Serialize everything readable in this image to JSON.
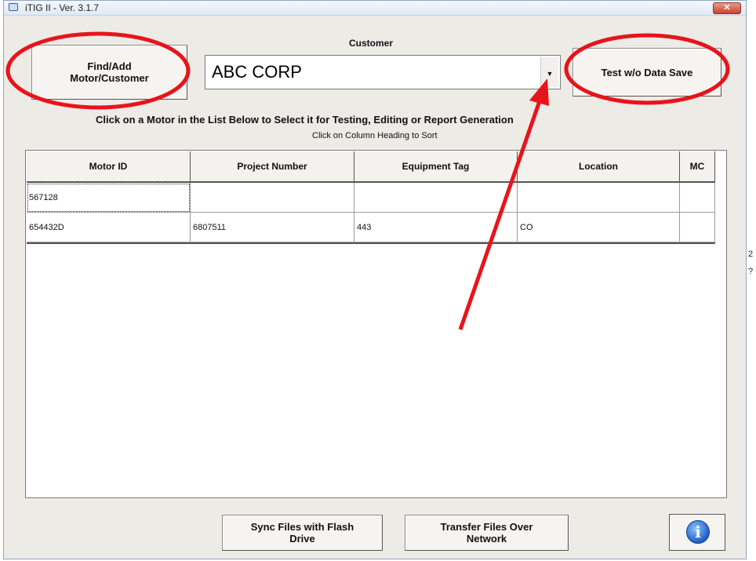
{
  "window": {
    "title": "iTIG II - Ver. 3.1.7",
    "close_glyph": "✕"
  },
  "side_fragments": [
    "2",
    "?"
  ],
  "toolbar": {
    "find_add_line1": "Find/Add",
    "find_add_line2": "Motor/Customer",
    "test_label": "Test w/o Data Save"
  },
  "customer": {
    "label": "Customer",
    "value": "ABC CORP",
    "dropdown_glyph": "▼"
  },
  "instructions": {
    "line1": "Click on a Motor in the List Below to Select it for Testing, Editing or Report Generation",
    "line2": "Click on Column Heading to Sort"
  },
  "table": {
    "columns": [
      "Motor ID",
      "Project Number",
      "Equipment Tag",
      "Location",
      "MC"
    ],
    "rows": [
      [
        "567128",
        "",
        "",
        "",
        ""
      ],
      [
        "654432D",
        "6807511",
        "443",
        "CO",
        ""
      ]
    ]
  },
  "footer": {
    "sync_line1": "Sync Files with  Flash",
    "sync_line2": "Drive",
    "transfer_line1": "Transfer Files Over",
    "transfer_line2": "Network",
    "info_glyph": "i"
  },
  "annotations": {
    "highlight_color": "#e8141b",
    "icons": [
      "app-icon",
      "close-icon",
      "dropdown-arrow-icon",
      "info-icon",
      "circle-highlight",
      "arrow-annotation"
    ]
  }
}
